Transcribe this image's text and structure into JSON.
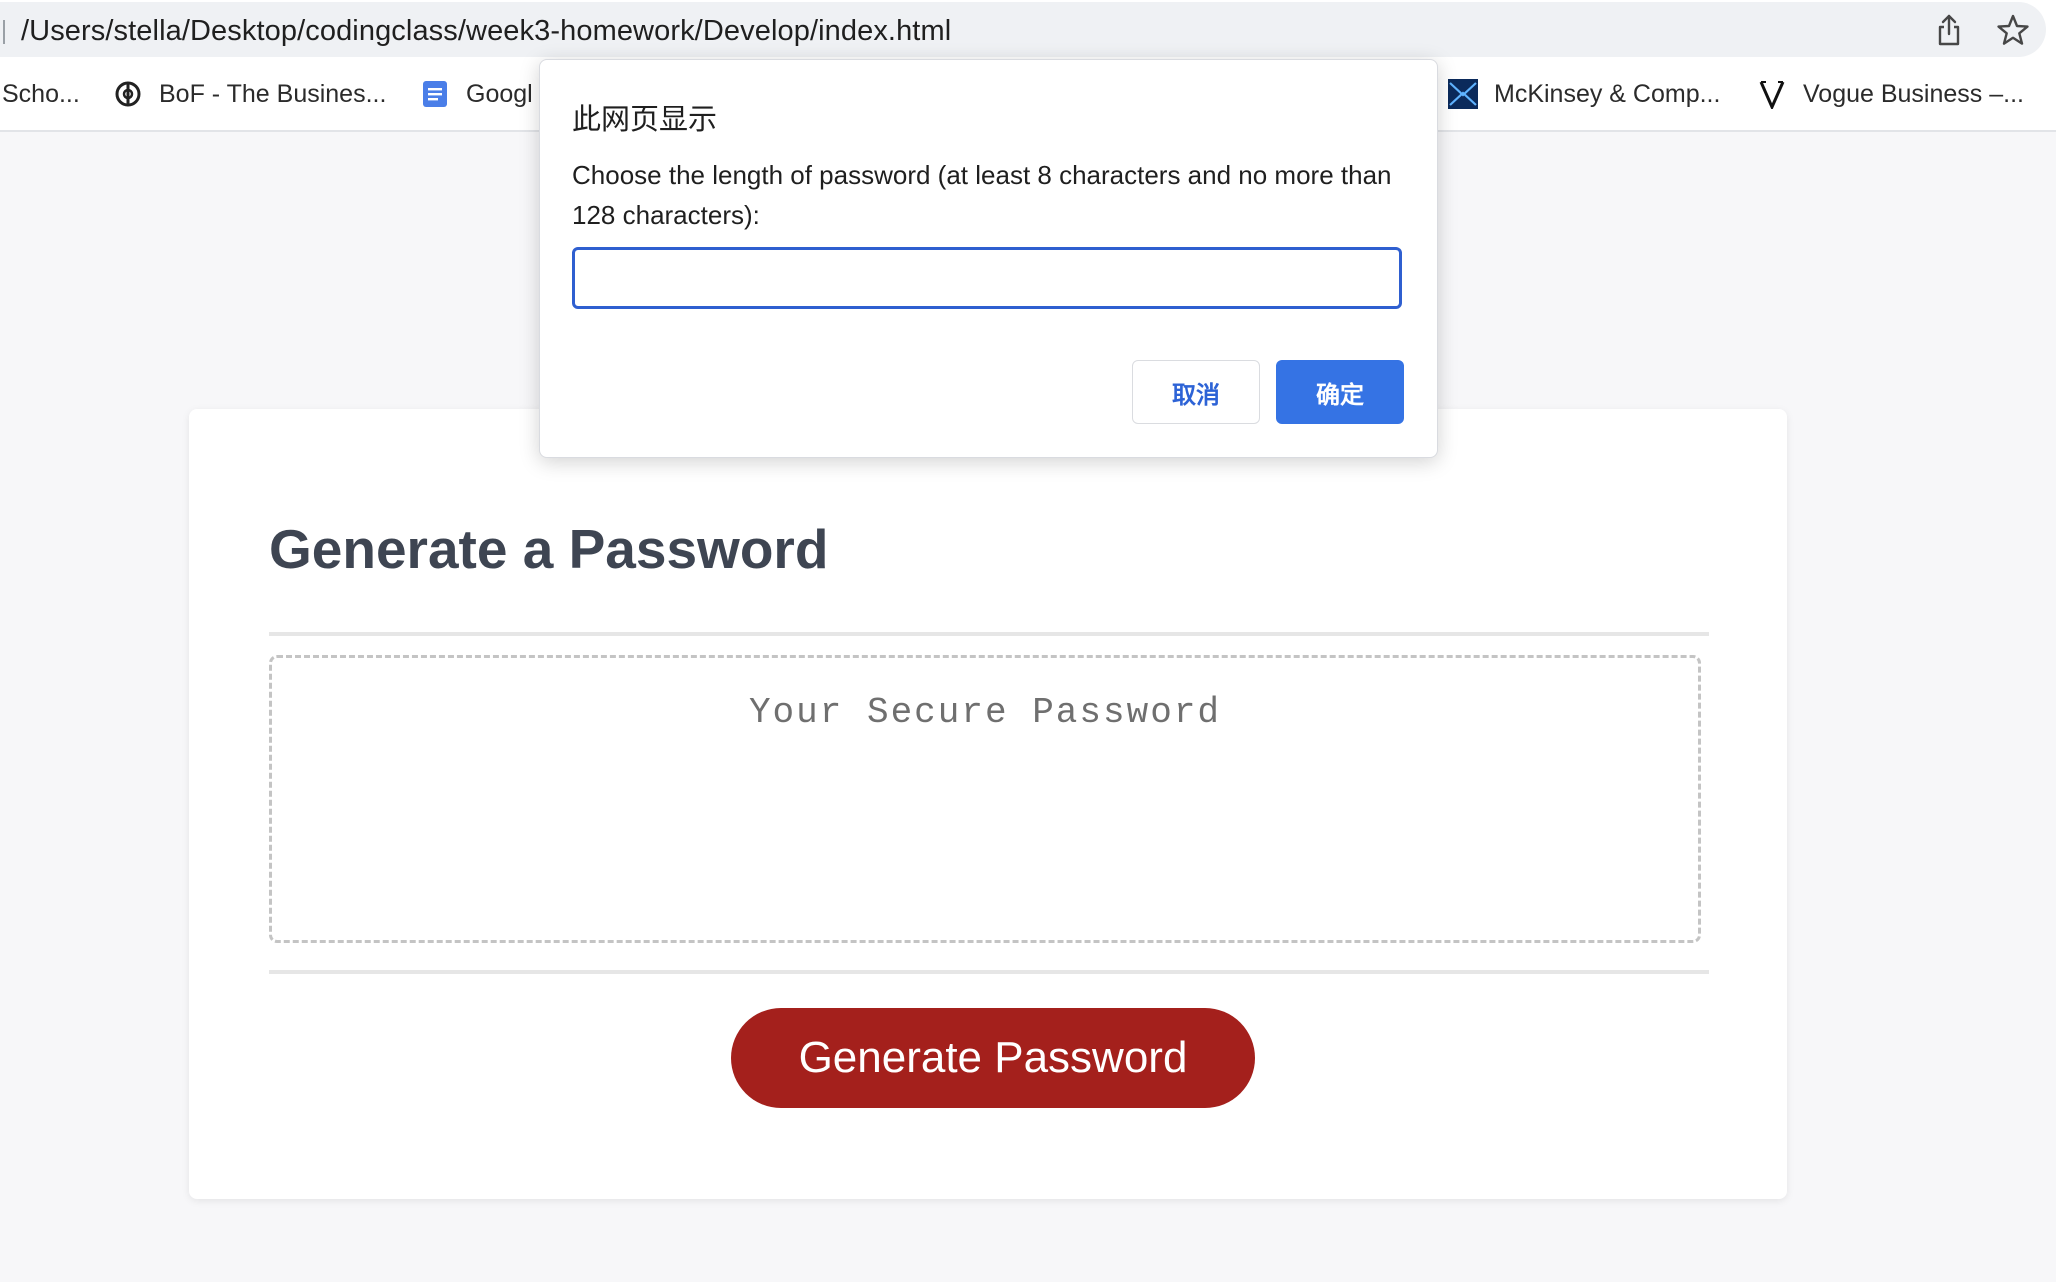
{
  "browser": {
    "url": "/Users/stella/Desktop/codingclass/week3-homework/Develop/index.html",
    "bookmarks": [
      {
        "label": "Scho..."
      },
      {
        "label": "BoF - The Busines..."
      },
      {
        "label": "Googl"
      },
      {
        "label": "McKinsey & Comp..."
      },
      {
        "label": "Vogue Business –..."
      }
    ]
  },
  "dialog": {
    "title": "此网页显示",
    "message": "Choose the length of password (at least 8 characters and no more than 128 characters):",
    "input_value": "",
    "cancel_label": "取消",
    "ok_label": "确定"
  },
  "page": {
    "title": "Generate a Password",
    "password_placeholder": "Your Secure Password",
    "generate_button_label": "Generate Password"
  },
  "colors": {
    "generate_button": "#a4201c",
    "dialog_ok": "#3573e4",
    "dialog_input_border": "#2f5fd0"
  }
}
